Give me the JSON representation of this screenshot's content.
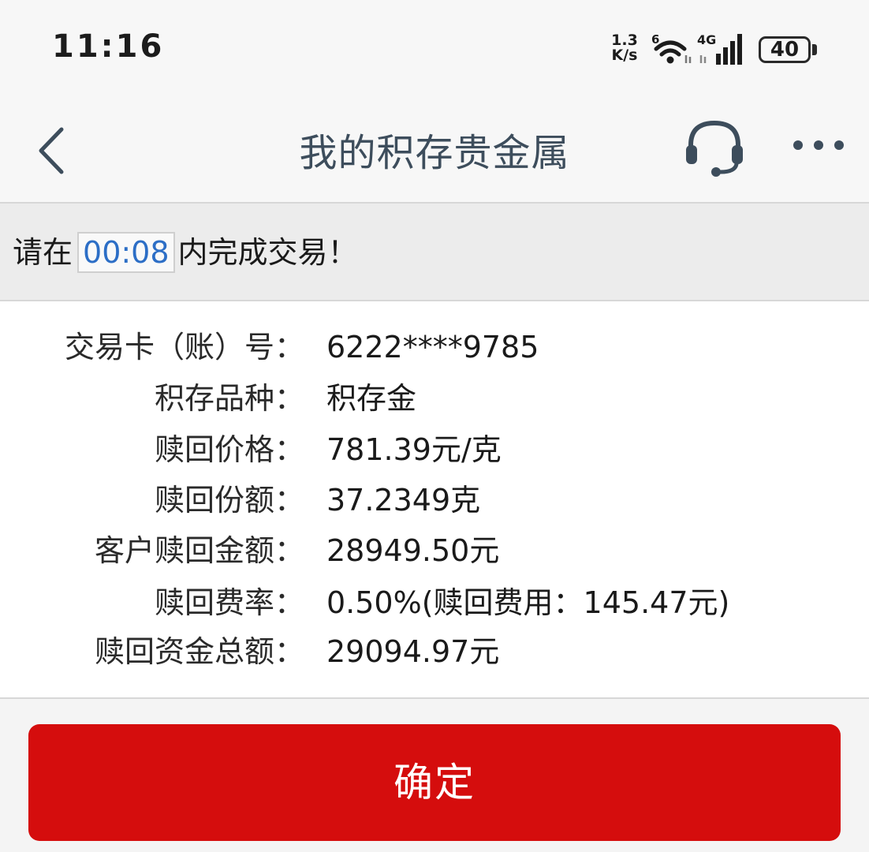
{
  "status_bar": {
    "time": "11:16",
    "net_speed_value": "1.3",
    "net_speed_unit": "K/s",
    "wifi_label": "6",
    "cell_label": "4G",
    "battery": "40",
    "wifi_icon": "wifi-6-icon",
    "cell_icon": "cell-signal-4g-icon"
  },
  "header": {
    "title": "我的积存贵金属",
    "back_icon": "chevron-left-icon",
    "service_icon": "headset-icon",
    "more_icon": "more-dots-icon"
  },
  "countdown": {
    "prefix": "请在",
    "time": "00:08",
    "suffix": "内完成交易！"
  },
  "details": [
    {
      "label": "交易卡（账）号：",
      "value": "6222****9785"
    },
    {
      "label": "积存品种：",
      "value": "积存金"
    },
    {
      "label": "赎回价格：",
      "value": "781.39元/克"
    },
    {
      "label": "赎回份额：",
      "value": "37.2349克"
    },
    {
      "label": "客户赎回金额：",
      "value": "28949.50元"
    },
    {
      "label": "赎回费率：",
      "value": "0.50%(赎回费用：145.47元)"
    },
    {
      "label": "赎回资金总额：",
      "value": "29094.97元"
    }
  ],
  "confirm_button": {
    "label": "确定"
  },
  "colors": {
    "accent_red": "#d50d0d",
    "timer_blue": "#2c6ec6",
    "title_color": "#3d4d5c"
  }
}
